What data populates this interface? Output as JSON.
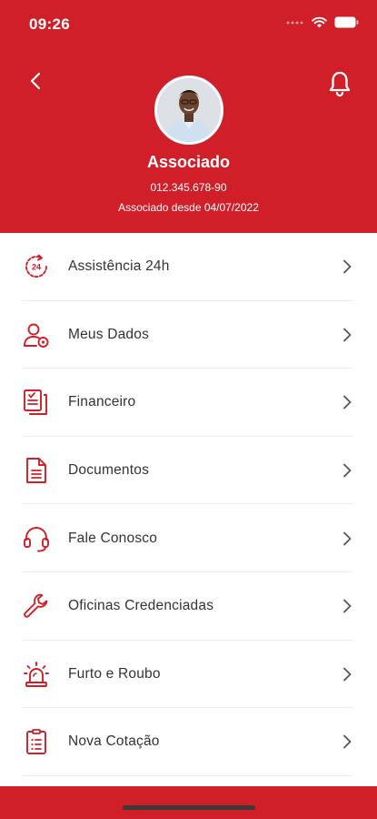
{
  "status_bar": {
    "time": "09:26"
  },
  "profile": {
    "name": "Associado",
    "cpf": "012.345.678-90",
    "member_since": "Associado desde 04/07/2022"
  },
  "menu": [
    {
      "label": "Assistência 24h",
      "icon": "assistance-24h-icon"
    },
    {
      "label": "Meus Dados",
      "icon": "user-settings-icon"
    },
    {
      "label": "Financeiro",
      "icon": "financial-document-icon"
    },
    {
      "label": "Documentos",
      "icon": "document-icon"
    },
    {
      "label": "Fale Conosco",
      "icon": "headset-icon"
    },
    {
      "label": "Oficinas Credenciadas",
      "icon": "wrench-icon"
    },
    {
      "label": "Furto e Roubo",
      "icon": "siren-icon"
    },
    {
      "label": "Nova Cotação",
      "icon": "clipboard-icon"
    }
  ],
  "colors": {
    "brand": "#d01f28",
    "text": "#333333",
    "divider": "#ececec"
  }
}
